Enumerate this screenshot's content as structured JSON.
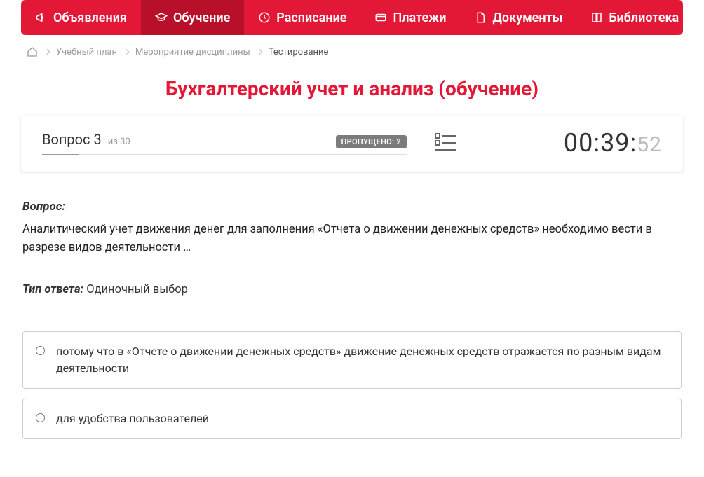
{
  "nav": {
    "items": [
      {
        "label": "Объявления",
        "icon": "megaphone"
      },
      {
        "label": "Обучение",
        "icon": "cap",
        "active": true
      },
      {
        "label": "Расписание",
        "icon": "clock"
      },
      {
        "label": "Платежи",
        "icon": "card"
      },
      {
        "label": "Документы",
        "icon": "doc"
      },
      {
        "label": "Библиотека",
        "icon": "book",
        "dropdown": true
      }
    ]
  },
  "breadcrumb": {
    "items": [
      {
        "label": "Учебный план"
      },
      {
        "label": "Мероприятие дисциплины"
      },
      {
        "label": "Тестирование",
        "current": true
      }
    ]
  },
  "page_title": "Бухгалтерский учет и анализ (обучение)",
  "status": {
    "question_word": "Вопрос",
    "question_num": "3",
    "of_word": "из",
    "total": "30",
    "skipped_label": "ПРОПУЩЕНО:",
    "skipped_count": "2",
    "timer_main": "00:39:",
    "timer_sec": "52",
    "progress_pct": 10
  },
  "question": {
    "label": "Вопрос:",
    "text": "Аналитический учет движения денег для заполнения «Отчета о движении денежных средств» необходимо вести в разрезе видов деятельности …",
    "answer_type_label": "Тип ответа:",
    "answer_type_value": "Одиночный выбор"
  },
  "answers": [
    {
      "text": "потому что в «Отчете о движении денежных средств» движение денежных средств отражается по разным видам деятельности"
    },
    {
      "text": "для удобства пользователей"
    }
  ]
}
